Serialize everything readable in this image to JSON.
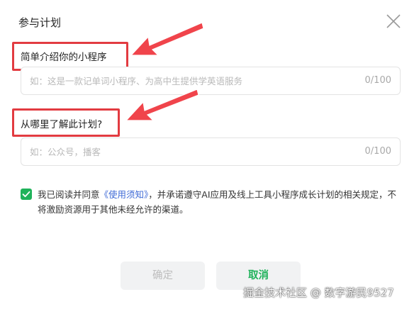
{
  "dialog": {
    "title": "参与计划",
    "close_icon": "close-icon"
  },
  "fields": [
    {
      "label": "简单介绍你的小程序",
      "placeholder": "如：这是一款记单词小程序、为高中生提供学英语服务",
      "value": "",
      "counter": "0/100"
    },
    {
      "label": "从哪里了解此计划?",
      "placeholder": "如：公众号，播客",
      "value": "",
      "counter": "0/100"
    }
  ],
  "agreement": {
    "checked": true,
    "checkbox_icon": "checkmark-icon",
    "text_before": "我已阅读并同意",
    "link": "《使用须知》",
    "text_after": "，并承诺遵守AI应用及线上工具小程序成长计划的相关规定，不将激励资源用于其他未经允许的渠道。"
  },
  "buttons": {
    "ok_label": "确定",
    "cancel_label": "取消"
  },
  "annotations": {
    "arrow_icon": "red-arrow-icon",
    "highlight_color": "#e23b41"
  },
  "watermark": "掘金技术社区 @ 数字游民9527",
  "colors": {
    "accent": "#1fb25a",
    "link": "#3d69d6",
    "annotation": "#e23b41"
  }
}
